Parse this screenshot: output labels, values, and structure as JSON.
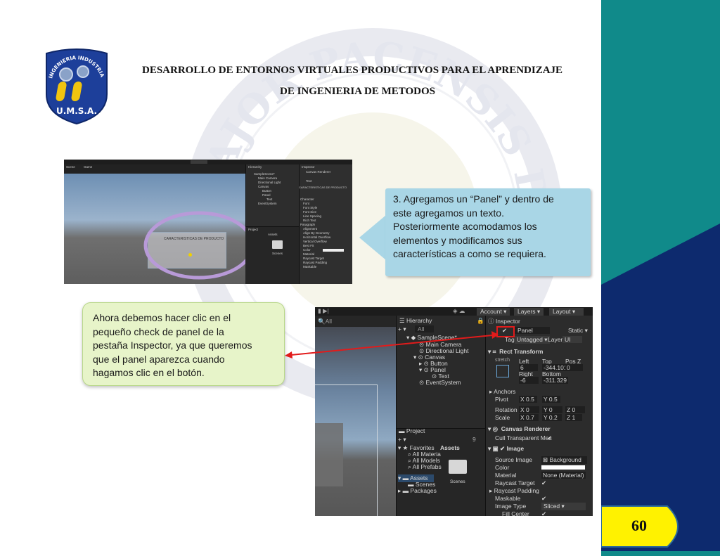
{
  "header": {
    "title_line1": "DESARROLLO DE ENTORNOS VIRTUALES PRODUCTIVOS PARA EL APRENDIZAJE",
    "title_line2": "DE INGENIERIA DE METODOS"
  },
  "logo": {
    "arc_text": "INGENIERIA INDUSTRIAL",
    "institution": "U.M.S.A."
  },
  "watermark": {
    "text": "MAJOR PACENSIS DI"
  },
  "callouts": {
    "step3": {
      "line1": "3. Agregamos un “Panel” y dentro de",
      "line2": "este agregamos un texto.",
      "line3": "Posteriormente acomodamos los",
      "line4": "elementos y modificamos sus",
      "line5": "características a como se requiera."
    },
    "note": {
      "line1": "Ahora debemos hacer clic en el",
      "line2": "pequeño check de panel de la",
      "line3": "pestaña Inspector, ya que queremos",
      "line4": "que el panel aparezca cuando",
      "line5": "hagamos clic en el botón."
    }
  },
  "page": {
    "number": "60"
  },
  "screenshot1": {
    "hierarchy_title": "Hierarchy",
    "inspector_title": "Inspector",
    "scene_tab": "Scene",
    "game_tab": "Game",
    "tree": [
      "SampleScene*",
      "Main Camera",
      "Directional Light",
      "Canvas",
      "Button",
      "Panel",
      "Text",
      "EventSystem"
    ],
    "component": "Canvas Renderer",
    "text_label": "Text",
    "text_value": "CARACTERISTICAS DE PRODUCTO",
    "scene_text": "CARACTERISTICAS DE PRODUCTO",
    "sections": [
      "Character",
      "Paragraph"
    ],
    "props": [
      "Font",
      "Font Style",
      "Font Size",
      "Line Spacing",
      "Rich Text",
      "Alignment",
      "Align By Geometry",
      "Horizontal Overflow",
      "Vertical Overflow",
      "Best Fit",
      "Color",
      "Material",
      "Raycast Target",
      "Raycast Padding",
      "Maskable"
    ],
    "project_tab": "Project",
    "assets_label": "Assets",
    "scenes_label": "Scenes"
  },
  "screenshot2": {
    "toolbar": {
      "account": "Account",
      "layers": "Layers",
      "layout": "Layout"
    },
    "hierarchy": {
      "title": "Hierarchy",
      "search": "All",
      "items": [
        "SampleScene*",
        "Main Camera",
        "Directional Light",
        "Canvas",
        "Button",
        "Panel",
        "Text",
        "EventSystem"
      ]
    },
    "scene_search": "All",
    "inspector": {
      "title": "Inspector",
      "object_name": "Panel",
      "static": "Static",
      "tag_label": "Tag",
      "tag_value": "Untagged",
      "layer_label": "Layer",
      "layer_value": "UI",
      "rect_transform": "Rect Transform",
      "stretch": "stretch",
      "left_label": "Left",
      "left_value": "6",
      "top_label": "Top",
      "top_value": "-344.101",
      "posz_label": "Pos Z",
      "posz_value": "0",
      "right_label": "Right",
      "right_value": "-6",
      "bottom_label": "Bottom",
      "bottom_value": "-311.329",
      "anchors": "Anchors",
      "pivot_label": "Pivot",
      "pivot_x": "X 0.5",
      "pivot_y": "Y 0.5",
      "rotation_label": "Rotation",
      "rot_x": "X 0",
      "rot_y": "Y 0",
      "rot_z": "Z 0",
      "scale_label": "Scale",
      "scale_x": "X 0.7",
      "scale_y": "Y 0.2",
      "scale_z": "Z 1",
      "canvas_renderer": "Canvas Renderer",
      "cull_transparent": "Cull Transparent Mes",
      "image": "Image",
      "source_image_label": "Source Image",
      "source_image_value": "Background",
      "color_label": "Color",
      "material_label": "Material",
      "material_value": "None (Material)",
      "raycast_target": "Raycast Target",
      "raycast_padding": "Raycast Padding",
      "maskable": "Maskable",
      "image_type_label": "Image Type",
      "image_type_value": "Sliced",
      "fill_center": "Fill Center"
    },
    "project": {
      "title": "Project",
      "count": "9",
      "favorites": "Favorites",
      "fav_items": [
        "All Materia",
        "All Models",
        "All Prefabs"
      ],
      "assets": "Assets",
      "asset_items": [
        "Scenes",
        "Packages"
      ],
      "content_title": "Assets",
      "folder": "Scenes"
    }
  },
  "colors": {
    "right_band_teal": "#108a8a",
    "right_band_navy": "#0d2a6e",
    "page_badge": "#fff200",
    "callout_blue": "#a9d6e6",
    "callout_green": "#e7f4c9",
    "highlight_ring": "#b89ad8",
    "pointer_arrow": "#e21b1b"
  }
}
